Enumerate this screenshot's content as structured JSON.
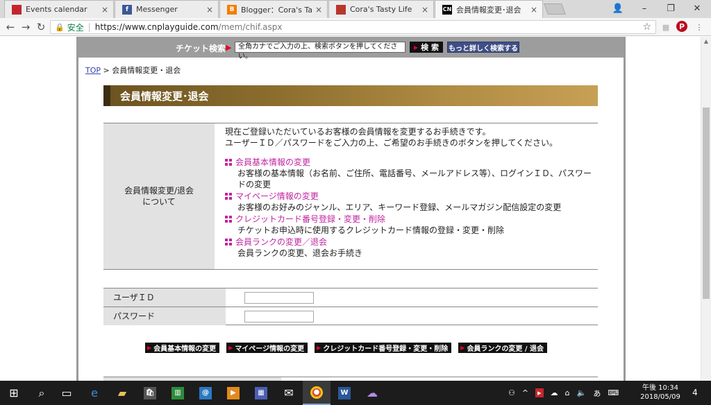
{
  "browser": {
    "tabs": [
      {
        "title": "Events calendar",
        "favicon_color": "#c4262e",
        "favicon_glyph": ""
      },
      {
        "title": "Messenger",
        "favicon_color": "#3b5998",
        "favicon_glyph": "f"
      },
      {
        "title": "Blogger：Cora's Tasty Life",
        "favicon_color": "#f57d00",
        "favicon_glyph": "B"
      },
      {
        "title": "Cora's Tasty Life",
        "favicon_color": "#b8362c",
        "favicon_glyph": ""
      },
      {
        "title": "会員情報変更･退会",
        "favicon_color": "#000000",
        "favicon_glyph": "CN"
      }
    ],
    "url": {
      "secure_label": "安全",
      "host": "https://www.cnplayguide.com",
      "path": "/mem/chif.aspx"
    }
  },
  "ticket_search": {
    "label": "チケット検索",
    "input_placeholder": "全角カナでご入力の上、検索ボタンを押してください。",
    "search_button": "検 索",
    "advanced_button": "もっと詳しく検索する"
  },
  "breadcrumb": {
    "top": "TOP",
    "separator": ">",
    "current": "会員情報変更・退会"
  },
  "page_title": "会員情報変更･退会",
  "about": {
    "heading_line1": "会員情報変更/退会",
    "heading_line2": "について",
    "intro_line1": "現在ご登録いただいているお客様の会員情報を変更するお手続きです。",
    "intro_line2": "ユーザーＩＤ／パスワードをご入力の上、ご希望のお手続きのボタンを押してください。",
    "items": [
      {
        "title": "会員基本情報の変更",
        "desc": "お客様の基本情報（お名前、ご住所、電話番号、メールアドレス等）、ログインＩＤ、パスワードの変更"
      },
      {
        "title": "マイページ情報の変更",
        "desc": "お客様のお好みのジャンル、エリア、キーワード登録、メールマガジン配信設定の変更"
      },
      {
        "title": "クレジットカード番号登録・変更・削除",
        "desc": "チケットお申込時に使用するクレジットカード情報の登録・変更・削除"
      },
      {
        "title": "会員ランクの変更／退会",
        "desc": "会員ランクの変更、退会お手続き"
      }
    ]
  },
  "login": {
    "user_id_label": "ユーザＩＤ",
    "password_label": "パスワード",
    "user_id_value": "",
    "password_value": ""
  },
  "actions": [
    "会員基本情報の変更",
    "マイページ情報の変更",
    "クレジットカード番号登録・変更・削除",
    "会員ランクの変更 / 退会"
  ],
  "taskbar": {
    "time_prefix": "午後",
    "time": "10:34",
    "date": "2018/05/09",
    "notification_count": "4"
  }
}
